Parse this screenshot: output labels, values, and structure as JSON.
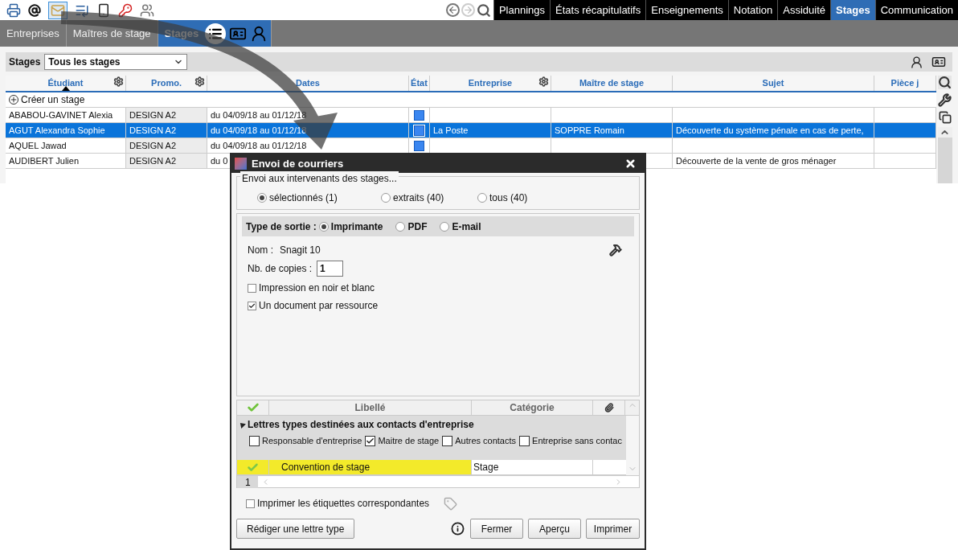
{
  "main_tabs": [
    {
      "label": "Plannings",
      "selected": false
    },
    {
      "label": "États récapitulatifs",
      "selected": false
    },
    {
      "label": "Enseignements",
      "selected": false
    },
    {
      "label": "Notation",
      "selected": false
    },
    {
      "label": "Assiduité",
      "selected": false
    },
    {
      "label": "Stages",
      "selected": true
    },
    {
      "label": "Communication",
      "selected": false
    }
  ],
  "sub_tabs": [
    {
      "label": "Entreprises",
      "selected": false
    },
    {
      "label": "Maîtres de stage",
      "selected": false
    },
    {
      "label": "Stages",
      "selected": true
    }
  ],
  "filter": {
    "label": "Stages",
    "value": "Tous les stages"
  },
  "table": {
    "columns": [
      {
        "label": "Étudiant",
        "settings": true,
        "sorted": true
      },
      {
        "label": "Promo.",
        "settings": true,
        "sorted": false
      },
      {
        "label": "Dates",
        "settings": false,
        "sorted": false
      },
      {
        "label": "État",
        "settings": false,
        "sorted": false
      },
      {
        "label": "Entreprise",
        "settings": true,
        "sorted": false
      },
      {
        "label": "Maître de stage",
        "settings": false,
        "sorted": false
      },
      {
        "label": "Sujet",
        "settings": false,
        "sorted": false
      },
      {
        "label": "Pièce j",
        "settings": false,
        "sorted": false
      }
    ],
    "create_label": "Créer un stage",
    "rows": [
      {
        "student": "ABABOU-GAVINET Alexia",
        "promo": "DESIGN A2",
        "dates": "du 04/09/18 au 01/12/18",
        "state_set": true,
        "company": "",
        "supervisor": "",
        "subject": "",
        "selected": false
      },
      {
        "student": "AGUT Alexandra Sophie",
        "promo": "DESIGN A2",
        "dates": "du 04/09/18 au 01/12/18",
        "state_set": true,
        "company": "La Poste",
        "supervisor": "SOPPRE Romain",
        "subject": "Découverte du système pénale en cas de perte,",
        "selected": true
      },
      {
        "student": "AQUEL Jawad",
        "promo": "DESIGN A2",
        "dates": "du 04/09/18 au 01/12/18",
        "state_set": true,
        "company": "",
        "supervisor": "",
        "subject": "",
        "selected": false
      },
      {
        "student": "AUDIBERT Julien",
        "promo": "DESIGN A2",
        "dates": "du 0",
        "subject": "Découverte de la vente de gros ménager",
        "selected": false
      }
    ]
  },
  "dialog": {
    "title": "Envoi de courriers",
    "recipients": {
      "legend": "Envoi aux intervenants des stages...",
      "options": [
        {
          "label": "sélectionnés (1)",
          "selected": true
        },
        {
          "label": "extraits (40)",
          "selected": false
        },
        {
          "label": "tous (40)",
          "selected": false
        }
      ]
    },
    "output": {
      "label": "Type de sortie :",
      "options": [
        {
          "label": "Imprimante",
          "selected": true
        },
        {
          "label": "PDF",
          "selected": false
        },
        {
          "label": "E-mail",
          "selected": false
        }
      ]
    },
    "printer": {
      "name_label": "Nom :",
      "name": "Snagit 10",
      "copies_label": "Nb. de copies :",
      "copies": "1"
    },
    "print_options": [
      {
        "label": "Impression en noir et blanc",
        "checked": false
      },
      {
        "label": "Un document par ressource",
        "checked": true
      }
    ],
    "letters": {
      "columns": [
        "Libellé",
        "Catégorie"
      ],
      "group": {
        "label": "Lettres types destinées aux contacts d'entreprise",
        "expanded": true,
        "filters": [
          {
            "label": "Responsable d'entreprise",
            "checked": false
          },
          {
            "label": "Maitre de stage",
            "checked": true
          },
          {
            "label": "Autres contacts",
            "checked": false
          },
          {
            "label": "Entreprise sans contac",
            "checked": false
          }
        ]
      },
      "rows": [
        {
          "label": "Convention de stage",
          "category": "Stage",
          "checked": true,
          "selected": true
        }
      ],
      "page": "1"
    },
    "labels_option": {
      "label": "Imprimer les étiquettes correspondantes",
      "checked": false
    },
    "buttons": {
      "write": "Rédiger une lettre type",
      "close": "Fermer",
      "preview": "Aperçu",
      "print": "Imprimer"
    }
  }
}
